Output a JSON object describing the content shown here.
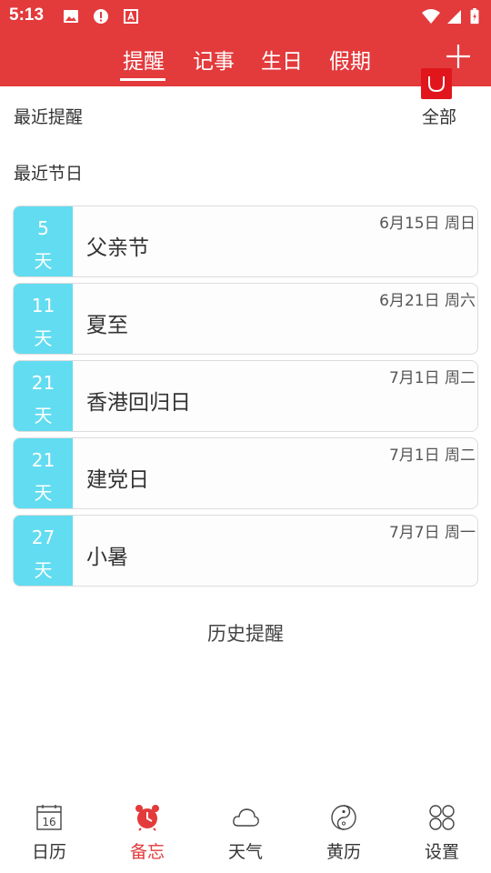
{
  "status_bar": {
    "time": "5:13"
  },
  "tabs": [
    {
      "label": "提醒",
      "active": true
    },
    {
      "label": "记事",
      "active": false
    },
    {
      "label": "生日",
      "active": false
    },
    {
      "label": "假期",
      "active": false
    }
  ],
  "recent_reminders": {
    "title": "最近提醒",
    "filter_label": "全部"
  },
  "recent_holidays": {
    "title": "最近节日",
    "toggle_symbol": "∪"
  },
  "holidays": [
    {
      "days": "5",
      "unit": "天",
      "name": "父亲节",
      "date": "6月15日 周日"
    },
    {
      "days": "11",
      "unit": "天",
      "name": "夏至",
      "date": "6月21日 周六"
    },
    {
      "days": "21",
      "unit": "天",
      "name": "香港回归日",
      "date": "7月1日 周二"
    },
    {
      "days": "21",
      "unit": "天",
      "name": "建党日",
      "date": "7月1日 周二"
    },
    {
      "days": "27",
      "unit": "天",
      "name": "小暑",
      "date": "7月7日 周一"
    }
  ],
  "history_label": "历史提醒",
  "bottom_nav": [
    {
      "label": "日历",
      "icon": "calendar-icon",
      "calendar_day": "16",
      "active": false
    },
    {
      "label": "备忘",
      "icon": "alarm-clock-icon",
      "active": true
    },
    {
      "label": "天气",
      "icon": "cloud-icon",
      "active": false
    },
    {
      "label": "黄历",
      "icon": "yin-yang-icon",
      "active": false
    },
    {
      "label": "设置",
      "icon": "settings-grid-icon",
      "active": false
    }
  ],
  "colors": {
    "brand": "#e33a3c",
    "days_badge": "#62dcf0",
    "toggle": "#e0161c"
  }
}
